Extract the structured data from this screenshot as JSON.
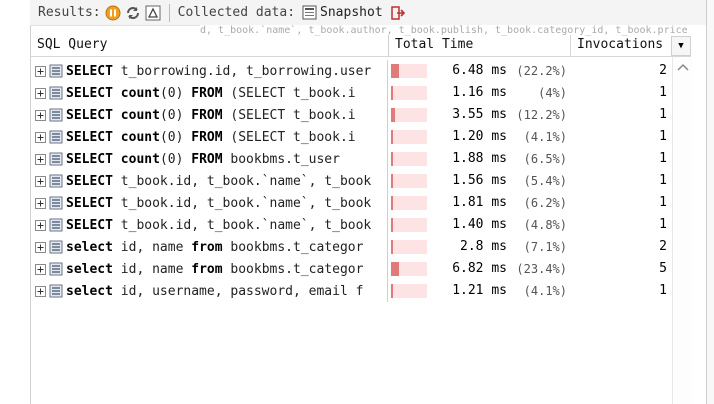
{
  "toolbar": {
    "results_label": "Results:",
    "collected_label": "Collected data:",
    "snapshot_label": "Snapshot"
  },
  "tooltip_text": "d, t_book.`name`, t_book.author, t_book.publish, t_book.category_id, t_book.price",
  "columns": {
    "sql": "SQL Query",
    "time": "Total Time",
    "invocations": "Invocations"
  },
  "colors": {
    "bar_fill": "#e07b7b",
    "bar_track": "#fde3e3"
  },
  "rows": [
    {
      "parts": [
        [
          "SELECT",
          "k"
        ],
        [
          " t_borrowing.id, t_borrowing.user",
          "t"
        ]
      ],
      "time": "6.48 ms",
      "pct": "(22.2%)",
      "fraction": 0.222,
      "inv": "2"
    },
    {
      "parts": [
        [
          "SELECT",
          "k"
        ],
        [
          " ",
          "t"
        ],
        [
          "count",
          "k"
        ],
        [
          "(0) ",
          "t"
        ],
        [
          "FROM",
          "k"
        ],
        [
          " (SELECT t_book.i",
          "t"
        ]
      ],
      "time": "1.16 ms",
      "pct": "(4%)",
      "fraction": 0.04,
      "inv": "1"
    },
    {
      "parts": [
        [
          "SELECT",
          "k"
        ],
        [
          " ",
          "t"
        ],
        [
          "count",
          "k"
        ],
        [
          "(0) ",
          "t"
        ],
        [
          "FROM",
          "k"
        ],
        [
          " (SELECT t_book.i",
          "t"
        ]
      ],
      "time": "3.55 ms",
      "pct": "(12.2%)",
      "fraction": 0.122,
      "inv": "1"
    },
    {
      "parts": [
        [
          "SELECT",
          "k"
        ],
        [
          " ",
          "t"
        ],
        [
          "count",
          "k"
        ],
        [
          "(0) ",
          "t"
        ],
        [
          "FROM",
          "k"
        ],
        [
          " (SELECT t_book.i",
          "t"
        ]
      ],
      "time": "1.20 ms",
      "pct": "(4.1%)",
      "fraction": 0.041,
      "inv": "1"
    },
    {
      "parts": [
        [
          "SELECT",
          "k"
        ],
        [
          " ",
          "t"
        ],
        [
          "count",
          "k"
        ],
        [
          "(0) ",
          "t"
        ],
        [
          "FROM",
          "k"
        ],
        [
          " bookbms.t_user",
          "t"
        ]
      ],
      "time": "1.88 ms",
      "pct": "(6.5%)",
      "fraction": 0.065,
      "inv": "1"
    },
    {
      "parts": [
        [
          "SELECT",
          "k"
        ],
        [
          " t_book.id, t_book.`name`, t_book",
          "t"
        ]
      ],
      "time": "1.56 ms",
      "pct": "(5.4%)",
      "fraction": 0.054,
      "inv": "1"
    },
    {
      "parts": [
        [
          "SELECT",
          "k"
        ],
        [
          " t_book.id, t_book.`name`, t_book",
          "t"
        ]
      ],
      "time": "1.81 ms",
      "pct": "(6.2%)",
      "fraction": 0.062,
      "inv": "1"
    },
    {
      "parts": [
        [
          "SELECT",
          "k"
        ],
        [
          " t_book.id, t_book.`name`, t_book",
          "t"
        ]
      ],
      "time": "1.40 ms",
      "pct": "(4.8%)",
      "fraction": 0.048,
      "inv": "1"
    },
    {
      "parts": [
        [
          "select",
          "k"
        ],
        [
          " id, name ",
          "t"
        ],
        [
          "from",
          "k"
        ],
        [
          " bookbms.t_categor",
          "t"
        ]
      ],
      "time": "2.8 ms",
      "pct": "(7.1%)",
      "fraction": 0.071,
      "inv": "2"
    },
    {
      "parts": [
        [
          "select",
          "k"
        ],
        [
          " id, name ",
          "t"
        ],
        [
          "from",
          "k"
        ],
        [
          " bookbms.t_categor",
          "t"
        ]
      ],
      "time": "6.82 ms",
      "pct": "(23.4%)",
      "fraction": 0.234,
      "inv": "5"
    },
    {
      "parts": [
        [
          "select",
          "k"
        ],
        [
          " id, username, password, email f",
          "t"
        ]
      ],
      "time": "1.21 ms",
      "pct": "(4.1%)",
      "fraction": 0.041,
      "inv": "1"
    }
  ]
}
